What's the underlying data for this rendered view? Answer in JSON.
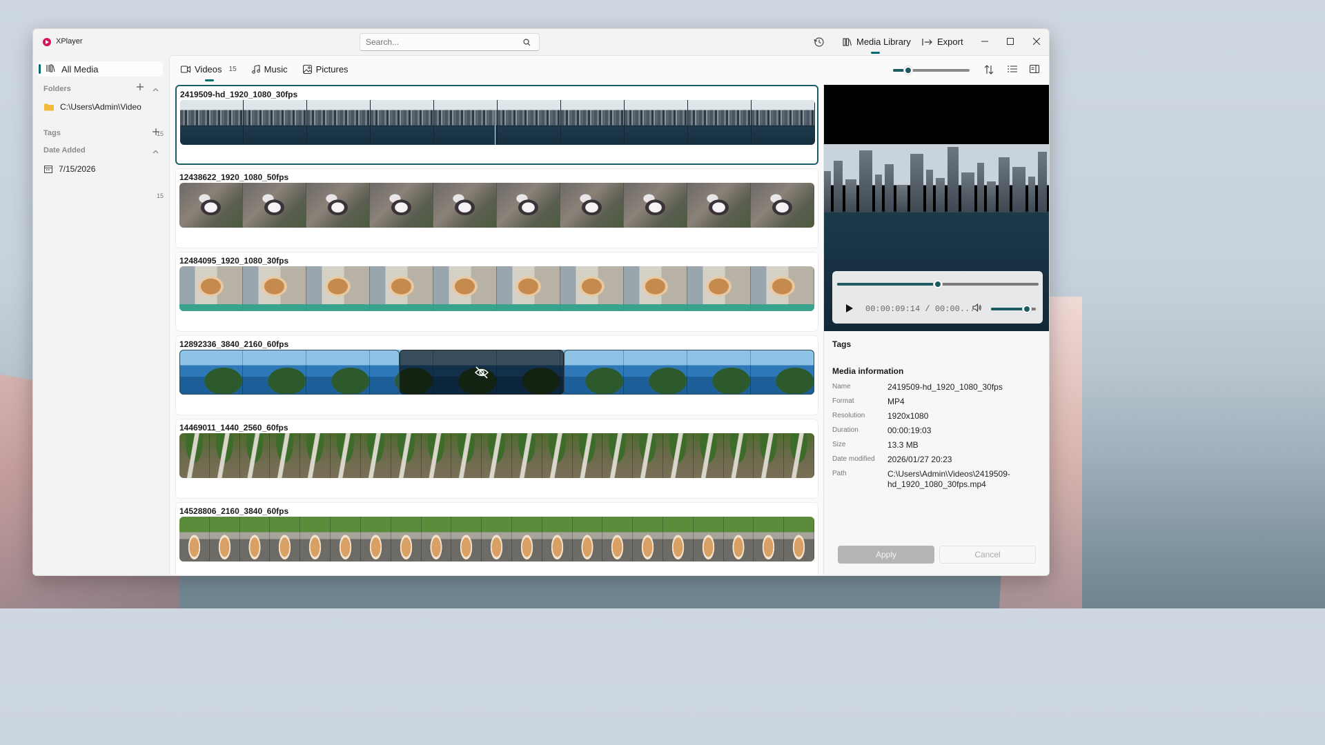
{
  "app": {
    "title": "XPlayer"
  },
  "search": {
    "placeholder": "Search..."
  },
  "titlebar": {
    "media_library": "Media Library",
    "export": "Export"
  },
  "sidebar": {
    "all_media": "All Media",
    "folders_label": "Folders",
    "folder": {
      "path": "C:\\Users\\Admin\\Video",
      "count": "15"
    },
    "tags_label": "Tags",
    "date_added_label": "Date Added",
    "date": {
      "value": "7/15/2026",
      "count": "15"
    }
  },
  "tabs": [
    {
      "label": "Videos",
      "count": "15"
    },
    {
      "label": "Music"
    },
    {
      "label": "Pictures"
    }
  ],
  "zoom_level": 0.2,
  "videos": [
    {
      "title": "2419509-hd_1920_1080_30fps",
      "thumb": "city",
      "selected": true
    },
    {
      "title": "12438622_1920_1080_50fps",
      "thumb": "kitten"
    },
    {
      "title": "12484095_1920_1080_30fps",
      "thumb": "chip"
    },
    {
      "title": "12892336_3840_2160_60fps",
      "thumb": "sea",
      "hidden_segment": true
    },
    {
      "title": "14469011_1440_2560_60fps",
      "thumb": "fall"
    },
    {
      "title": "14528806_2160_3840_60fps",
      "thumb": "cat"
    }
  ],
  "player": {
    "time": "00:00:09:14 / 00:00...",
    "progress": 0.5,
    "volume": 0.8
  },
  "detail": {
    "tags_heading": "Tags",
    "info_heading": "Media information",
    "info": [
      {
        "key": "Name",
        "value": "2419509-hd_1920_1080_30fps"
      },
      {
        "key": "Format",
        "value": "MP4"
      },
      {
        "key": "Resolution",
        "value": "1920x1080"
      },
      {
        "key": "Duration",
        "value": "00:00:19:03"
      },
      {
        "key": "Size",
        "value": "13.3 MB"
      },
      {
        "key": "Date modified",
        "value": "2026/01/27 20:23"
      },
      {
        "key": "Path",
        "value": "C:\\Users\\Admin\\Videos\\2419509-hd_1920_1080_30fps.mp4"
      }
    ],
    "apply": "Apply",
    "cancel": "Cancel"
  },
  "colors": {
    "accent": "#006b73",
    "slider": "#1e5a60"
  }
}
